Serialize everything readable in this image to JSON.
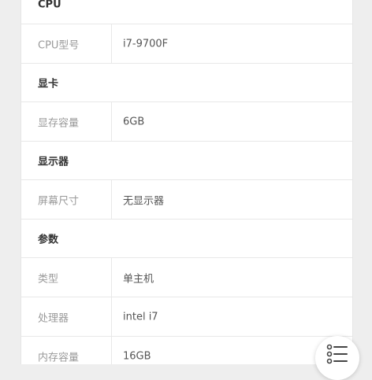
{
  "sections": [
    {
      "title": "CPU",
      "rows": [
        {
          "label": "CPU型号",
          "value": "i7-9700F"
        }
      ]
    },
    {
      "title": "显卡",
      "rows": [
        {
          "label": "显存容量",
          "value": "6GB"
        }
      ]
    },
    {
      "title": "显示器",
      "rows": [
        {
          "label": "屏幕尺寸",
          "value": "无显示器"
        }
      ]
    },
    {
      "title": "参数",
      "rows": [
        {
          "label": "类型",
          "value": "单主机"
        },
        {
          "label": "处理器",
          "value": "intel i7"
        },
        {
          "label": "内存容量",
          "value": "16GB"
        }
      ]
    }
  ],
  "floating_button": {
    "icon": "list-menu-icon"
  }
}
